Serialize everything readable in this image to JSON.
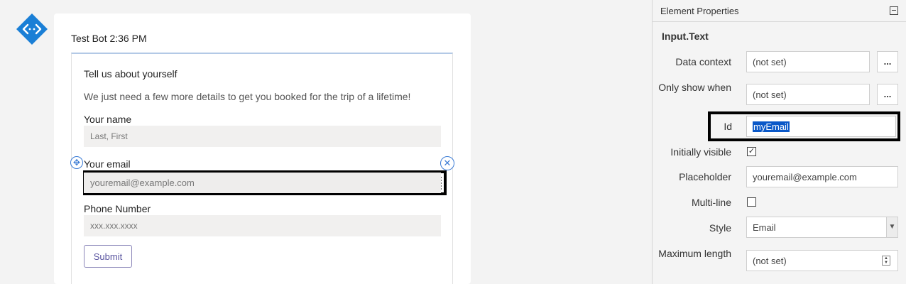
{
  "chat": {
    "meta": "Test Bot 2:36 PM",
    "card": {
      "title": "Tell us about yourself",
      "subtitle": "We just need a few more details to get you booked for the trip of a lifetime!",
      "fields": [
        {
          "label": "Your name",
          "placeholder": "Last, First"
        },
        {
          "label": "Your email",
          "placeholder": "youremail@example.com"
        },
        {
          "label": "Phone Number",
          "placeholder": "xxx.xxx.xxxx"
        }
      ],
      "submit_label": "Submit"
    }
  },
  "properties": {
    "header_title": "Element Properties",
    "element_type": "Input.Text",
    "data_context": {
      "label": "Data context",
      "value": "(not set)",
      "button": "..."
    },
    "only_show_when": {
      "label": "Only show when",
      "value": "(not set)",
      "button": "..."
    },
    "id": {
      "label": "Id",
      "value": "myEmail"
    },
    "initially_visible": {
      "label": "Initially visible",
      "checked": true,
      "mark": "✓"
    },
    "placeholder": {
      "label": "Placeholder",
      "value": "youremail@example.com"
    },
    "multi_line": {
      "label": "Multi-line",
      "checked": false
    },
    "style": {
      "label": "Style",
      "value": "Email"
    },
    "max_length": {
      "label": "Maximum length",
      "value": "(not set)"
    }
  },
  "icons": {
    "bot_avatar": "bot-logo-icon",
    "move_handle": "move-icon",
    "delete_handle": "close-circle-icon",
    "collapse": "collapse-icon",
    "dropdown": "chevron-down-icon",
    "spinner": "spinner-icon"
  },
  "colors": {
    "bot_avatar": "#1a7fd6",
    "selection_accent": "#3a7bd5",
    "id_highlight": "#0a58c8",
    "submit_text": "#5a55a0"
  }
}
